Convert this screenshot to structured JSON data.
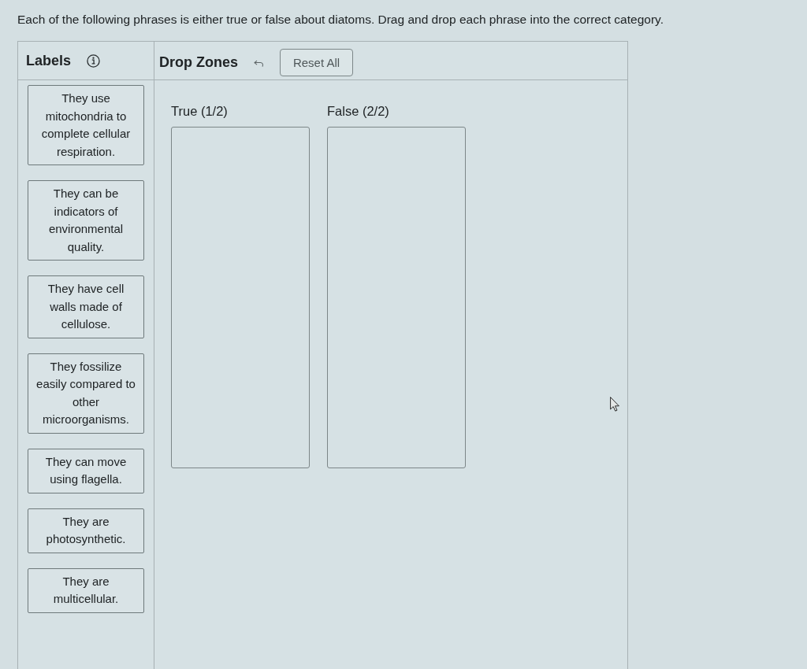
{
  "instructions": "Each of the following phrases is either true or false about diatoms. Drag and drop each phrase into the correct category.",
  "labels_panel": {
    "title": "Labels",
    "cards": [
      {
        "text": "They use mitochondria to complete cellular respiration."
      },
      {
        "text": "They can be indicators of environmental quality."
      },
      {
        "text": "They have cell walls made of cellulose."
      },
      {
        "text": "They fossilize easily compared to other microorganisms."
      },
      {
        "text": "They can move using flagella."
      },
      {
        "text": "They are photosynthetic."
      },
      {
        "text": "They are multicellular."
      }
    ]
  },
  "drop_zones_panel": {
    "title": "Drop Zones",
    "reset_button": "Reset All",
    "zones": [
      {
        "label": "True (1/2)"
      },
      {
        "label": "False (2/2)"
      }
    ]
  }
}
